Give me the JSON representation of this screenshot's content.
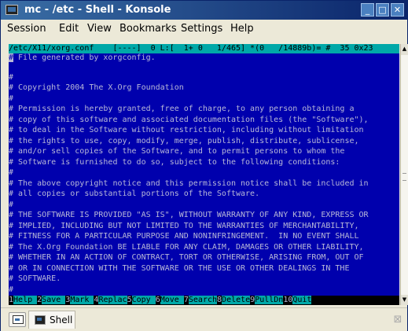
{
  "window": {
    "title": "mc - /etc - Shell - Konsole"
  },
  "title_buttons": {
    "minimize": "_",
    "maximize": "□",
    "close": "✕"
  },
  "menubar": [
    "Session",
    "Edit",
    "View",
    "Bookmarks",
    "Settings",
    "Help"
  ],
  "editor": {
    "status": "/etc/X11/xorg.conf    [----]  0 L:[  1+ 0   1/465] *(0   /14889b)= #  35 0x23",
    "cursor_char": "#",
    "first_line_rest": " File generated by xorgconfig.",
    "lines": [
      "",
      "#",
      "# Copyright 2004 The X.Org Foundation",
      "#",
      "# Permission is hereby granted, free of charge, to any person obtaining a",
      "# copy of this software and associated documentation files (the \"Software\"),",
      "# to deal in the Software without restriction, including without limitation",
      "# the rights to use, copy, modify, merge, publish, distribute, sublicense,",
      "# and/or sell copies of the Software, and to permit persons to whom the",
      "# Software is furnished to do so, subject to the following conditions:",
      "#",
      "# The above copyright notice and this permission notice shall be included in",
      "# all copies or substantial portions of the Software.",
      "#",
      "# THE SOFTWARE IS PROVIDED \"AS IS\", WITHOUT WARRANTY OF ANY KIND, EXPRESS OR",
      "# IMPLIED, INCLUDING BUT NOT LIMITED TO THE WARRANTIES OF MERCHANTABILITY,",
      "# FITNESS FOR A PARTICULAR PURPOSE AND NONINFRINGEMENT.  IN NO EVENT SHALL",
      "# The X.Org Foundation BE LIABLE FOR ANY CLAIM, DAMAGES OR OTHER LIABILITY,",
      "# WHETHER IN AN ACTION OF CONTRACT, TORT OR OTHERWISE, ARISING FROM, OUT OF",
      "# OR IN CONNECTION WITH THE SOFTWARE OR THE USE OR OTHER DEALINGS IN THE",
      "# SOFTWARE.",
      "#"
    ],
    "fkeys": [
      {
        "num": "1",
        "label": "Help  "
      },
      {
        "num": "2",
        "label": "Save  "
      },
      {
        "num": "3",
        "label": "Mark  "
      },
      {
        "num": "4",
        "label": "Replac"
      },
      {
        "num": "5",
        "label": "Copy  "
      },
      {
        "num": "6",
        "label": "Move  "
      },
      {
        "num": "7",
        "label": "Search"
      },
      {
        "num": "8",
        "label": "Delete"
      },
      {
        "num": "9",
        "label": "PullDn"
      },
      {
        "num": "10",
        "label": "Quit  "
      }
    ]
  },
  "tabs": {
    "active_label": "Shell"
  },
  "colors": {
    "titlebar_start": "#3a6ea5",
    "titlebar_end": "#0a246a",
    "terminal_bg": "#0000ad",
    "terminal_fg": "#b8b8d8",
    "status_bg": "#00a8a8"
  },
  "icons": {
    "app": "konsole-terminal-icon",
    "new_tab": "new-session-icon",
    "tab": "terminal-icon",
    "close_tab": "close-tab-icon"
  }
}
